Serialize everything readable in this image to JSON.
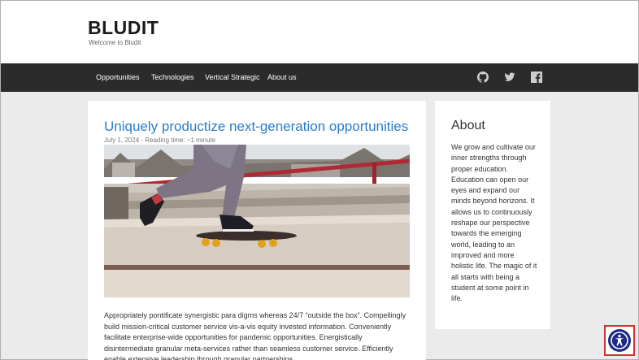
{
  "site": {
    "title": "BLUDIT",
    "slogan": "Welcome to Bludit"
  },
  "nav": {
    "items": [
      {
        "label": "Opportunities"
      },
      {
        "label": "Technologies"
      },
      {
        "label": "Vertical Strategic"
      },
      {
        "label": "About us"
      }
    ],
    "social": [
      "github-icon",
      "twitter-icon",
      "facebook-icon"
    ]
  },
  "post": {
    "title": "Uniquely productize next-generation opportunities",
    "meta": "July 1, 2024 - Reading time: ~1 minute",
    "image_alt": "skateboarder at skatepark",
    "body": "Appropriately pontificate synergistic para digms whereas 24/7 “outside the box”. Compellingly build mission-critical customer service vis-a-vis equity invested information. Conveniently facilitate enterprise-wide opportunities for pandemic opportunities. Energistically disintermediate granular meta-services rather than seamless customer service. Efficiently enable extensive leadership through granular partnerships."
  },
  "sidebar": {
    "title": "About",
    "text": "We grow and cultivate our inner strengths through proper education. Education can open our eyes and expand our minds beyond horizons. It allows us to continuously reshape our perspective towards the emerging world, leading to an improved and more holistic life. The magic of it all starts with being a student at some point in life."
  },
  "accessibility": {
    "icon": "accessibility-icon",
    "accent": "#1e2a8a",
    "highlight": "#d32f2f"
  },
  "colors": {
    "link": "#2a7cc7",
    "navbar": "#2b2b2b",
    "background": "#ebebeb"
  }
}
